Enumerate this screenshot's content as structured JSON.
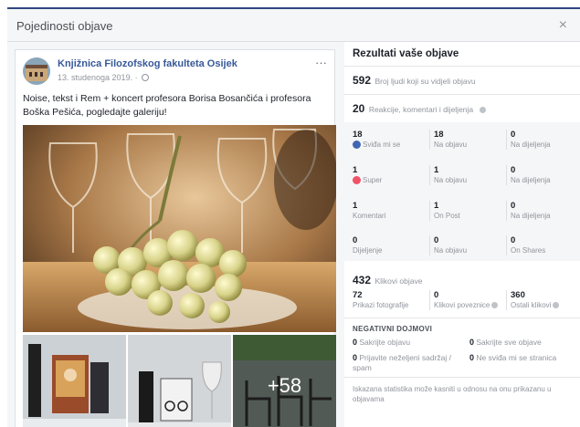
{
  "dialog": {
    "title": "Pojedinosti objave",
    "close_symbol": "×"
  },
  "post": {
    "page_name": "Knjižnica Filozofskog fakulteta Osijek",
    "date": "13. studenoga 2019.",
    "more_symbol": "···",
    "text": "Noise, tekst i Rem + koncert profesora Borisa Bosančića i profesora Boška Pešića, pogledajte galeriju!",
    "more_photos": "+58"
  },
  "stats": {
    "title": "Rezultati vaše objave",
    "reach": {
      "value": "592",
      "label": "Broj ljudi koji su vidjeli objavu"
    },
    "engagement": {
      "value": "20",
      "label": "Reakcije, komentari i dijeljenja"
    },
    "rows": [
      {
        "cells": [
          {
            "n": "18",
            "l": "Sviđa mi se"
          },
          {
            "n": "18",
            "l": "Na objavu"
          },
          {
            "n": "0",
            "l": "Na dijeljenja"
          }
        ]
      },
      {
        "cells": [
          {
            "n": "1",
            "l": "Super"
          },
          {
            "n": "1",
            "l": "Na objavu"
          },
          {
            "n": "0",
            "l": "Na dijeljenja"
          }
        ]
      },
      {
        "cells": [
          {
            "n": "1",
            "l": "Komentari"
          },
          {
            "n": "1",
            "l": "On Post"
          },
          {
            "n": "0",
            "l": "Na dijeljenja"
          }
        ]
      },
      {
        "cells": [
          {
            "n": "0",
            "l": "Dijeljenje"
          },
          {
            "n": "0",
            "l": "Na objavu"
          },
          {
            "n": "0",
            "l": "On Shares"
          }
        ]
      }
    ],
    "clicks": {
      "value": "432",
      "label": "Klikovi objave"
    },
    "click_cells": [
      {
        "n": "72",
        "l": "Prikazi fotografije"
      },
      {
        "n": "0",
        "l": "Klikovi poveznice"
      },
      {
        "n": "360",
        "l": "Ostali klikovi"
      }
    ],
    "negative": {
      "title": "NEGATIVNI DOJMOVI",
      "items": [
        {
          "n": "0",
          "l": "Sakrijte objavu"
        },
        {
          "n": "0",
          "l": "Sakrijte sve objave"
        },
        {
          "n": "0",
          "l": "Prijavite neželjeni sadržaj / spam"
        },
        {
          "n": "0",
          "l": "Ne sviđa mi se stranica"
        }
      ]
    },
    "footnote": "Iskazana statistika može kasniti u odnosu na onu prikazanu u objavama"
  }
}
